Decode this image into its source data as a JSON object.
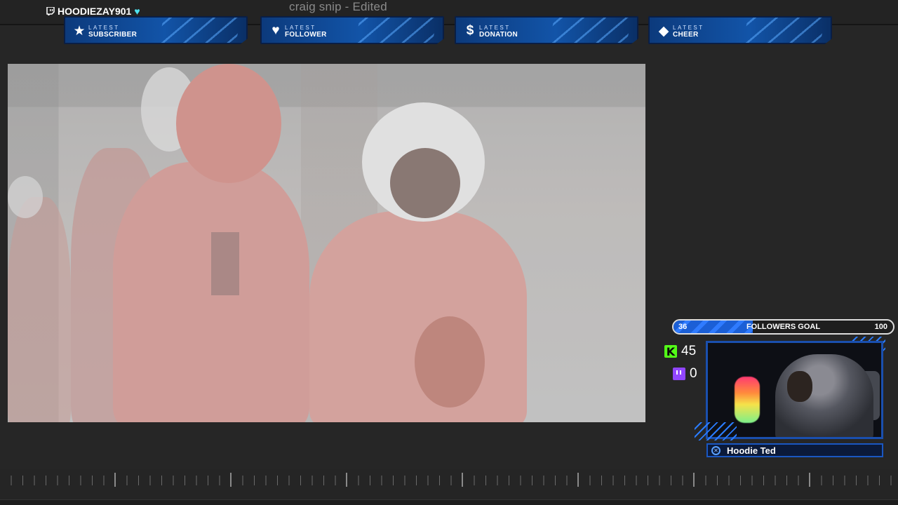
{
  "window": {
    "title": "craig snip - Edited"
  },
  "streamer": {
    "username": "HOODIEZAY901",
    "heart_icon": "heart-icon"
  },
  "alerts": [
    {
      "icon": "star-icon",
      "glyph": "★",
      "small": "LATEST",
      "big": "SUBSCRIBER"
    },
    {
      "icon": "heart-icon",
      "glyph": "♥",
      "small": "LATEST",
      "big": "FOLLOWER"
    },
    {
      "icon": "dollar-icon",
      "glyph": "$",
      "small": "LATEST",
      "big": "DONATION"
    },
    {
      "icon": "diamond-icon",
      "glyph": "◆",
      "small": "LATEST",
      "big": "CHEER"
    }
  ],
  "goal": {
    "current": "36",
    "label": "FOLLOWERS GOAL",
    "max": "100",
    "fraction": 0.36
  },
  "stats": {
    "kick_count": "45",
    "twitch_count": "0"
  },
  "webcam": {
    "name": "Hoodie Ted"
  },
  "colors": {
    "accent": "#1a57c2",
    "kick": "#53fc18",
    "twitch": "#9146ff",
    "heart": "#4fe3f0"
  }
}
